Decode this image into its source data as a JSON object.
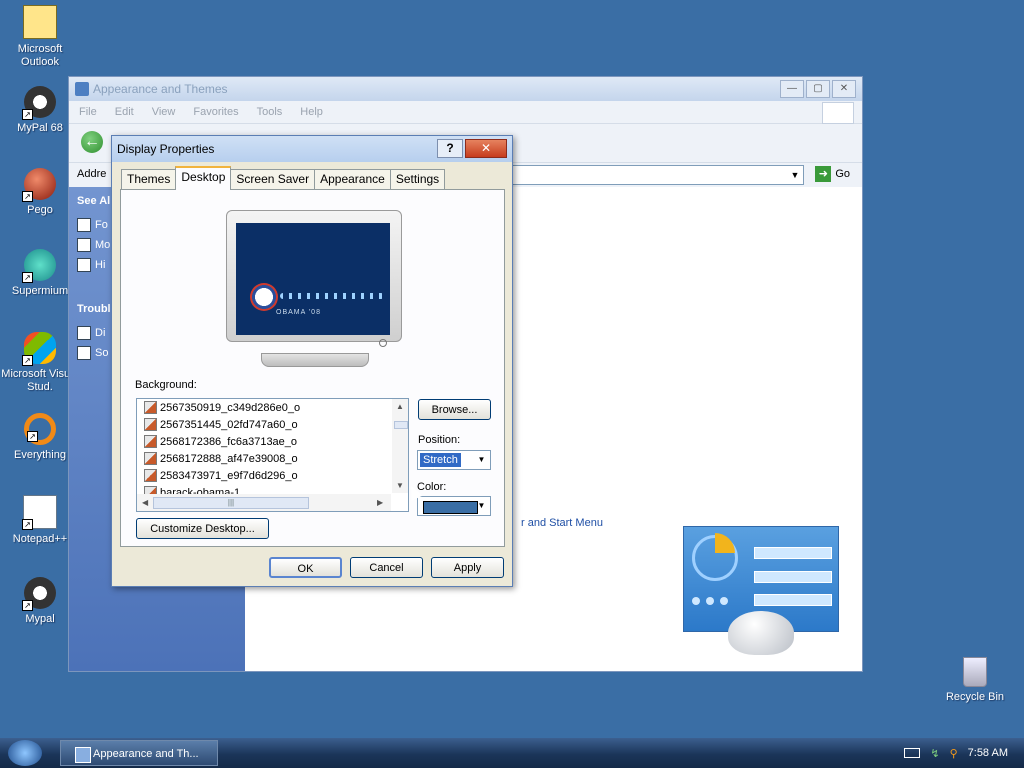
{
  "desktop_icons": [
    {
      "label": "Microsoft Outlook"
    },
    {
      "label": "MyPal 68"
    },
    {
      "label": "Pego"
    },
    {
      "label": "Supermium"
    },
    {
      "label": "Microsoft Visual Stud."
    },
    {
      "label": "Everything"
    },
    {
      "label": "Notepad++"
    },
    {
      "label": "Mypal"
    },
    {
      "label": "Recycle Bin"
    }
  ],
  "explorer": {
    "title": "Appearance and Themes",
    "menu": [
      "File",
      "Edit",
      "View",
      "Favorites",
      "Tools",
      "Help"
    ],
    "address_label": "Addre",
    "go_label": "Go",
    "left_sections": {
      "see_also": "See Al",
      "see_also_items": [
        "Fo",
        "Mo",
        "Hi"
      ],
      "troubleshooters": "Troubl",
      "troubleshooter_items": [
        "Di",
        "So"
      ]
    },
    "link_fragment": "r and Start Menu"
  },
  "dialog": {
    "title": "Display Properties",
    "help_glyph": "?",
    "close_glyph": "✕",
    "tabs": [
      "Themes",
      "Desktop",
      "Screen Saver",
      "Appearance",
      "Settings"
    ],
    "active_tab": "Desktop",
    "preview_text": "OBAMA '08",
    "background_label": "Background:",
    "background_items": [
      "2567350919_c349d286e0_o",
      "2567351445_02fd747a60_o",
      "2568172386_fc6a3713ae_o",
      "2568172888_af47e39008_o",
      "2583473971_e9f7d6d296_o",
      "barack-obama-1"
    ],
    "browse_label": "Browse...",
    "position_label": "Position:",
    "position_value": "Stretch",
    "color_label": "Color:",
    "color_value": "#3a6ea5",
    "customize_label": "Customize Desktop...",
    "ok_label": "OK",
    "cancel_label": "Cancel",
    "apply_label": "Apply"
  },
  "taskbar": {
    "task_label": "Appearance and Th...",
    "clock": "7:58 AM"
  },
  "colors": {
    "desktop": "#3a6ea5",
    "selection": "#316ac5"
  }
}
